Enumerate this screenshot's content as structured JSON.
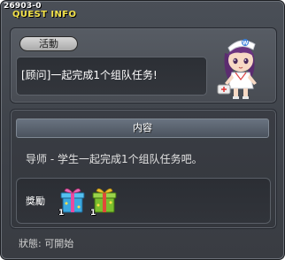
{
  "window": {
    "quest_id": "26903-0",
    "title": "QUEST INFO"
  },
  "activity": {
    "label": "活動",
    "text": "[顾问]一起完成1个组队任务!",
    "npc_icon": "nurse-npc-icon"
  },
  "content": {
    "header": "内容",
    "text": "导师 - 学生一起完成1个组队任务吧。",
    "reward_label": "獎勵",
    "rewards": [
      {
        "icon": "blue-gift-box-icon",
        "qty": "1"
      },
      {
        "icon": "green-gift-box-icon",
        "qty": "1"
      }
    ]
  },
  "status": "狀態: 可開始"
}
